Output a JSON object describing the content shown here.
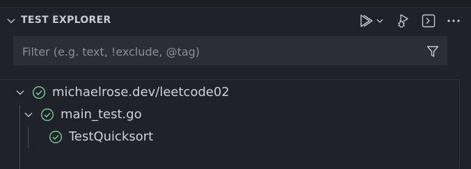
{
  "panel": {
    "title": "TEST EXPLORER"
  },
  "toolbar": {
    "run_tests_icon": "run-tests-icon",
    "run_dropdown_icon": "chevron-down-icon",
    "debug_tests_icon": "debug-tests-icon",
    "terminal_icon": "terminal-icon",
    "more_icon": "ellipsis-icon"
  },
  "filter": {
    "placeholder": "Filter (e.g. text, !exclude, @tag)",
    "value": ""
  },
  "tree": {
    "items": [
      {
        "label": "michaelrose.dev/leetcode02",
        "status": "passed",
        "expanded": true
      },
      {
        "label": "main_test.go",
        "status": "passed",
        "expanded": true
      },
      {
        "label": "TestQuicksort",
        "status": "passed"
      }
    ]
  },
  "colors": {
    "background": "#1f2329",
    "filter_background": "#2b2f35",
    "passed": "#73c991",
    "text": "#cfd3d8"
  }
}
